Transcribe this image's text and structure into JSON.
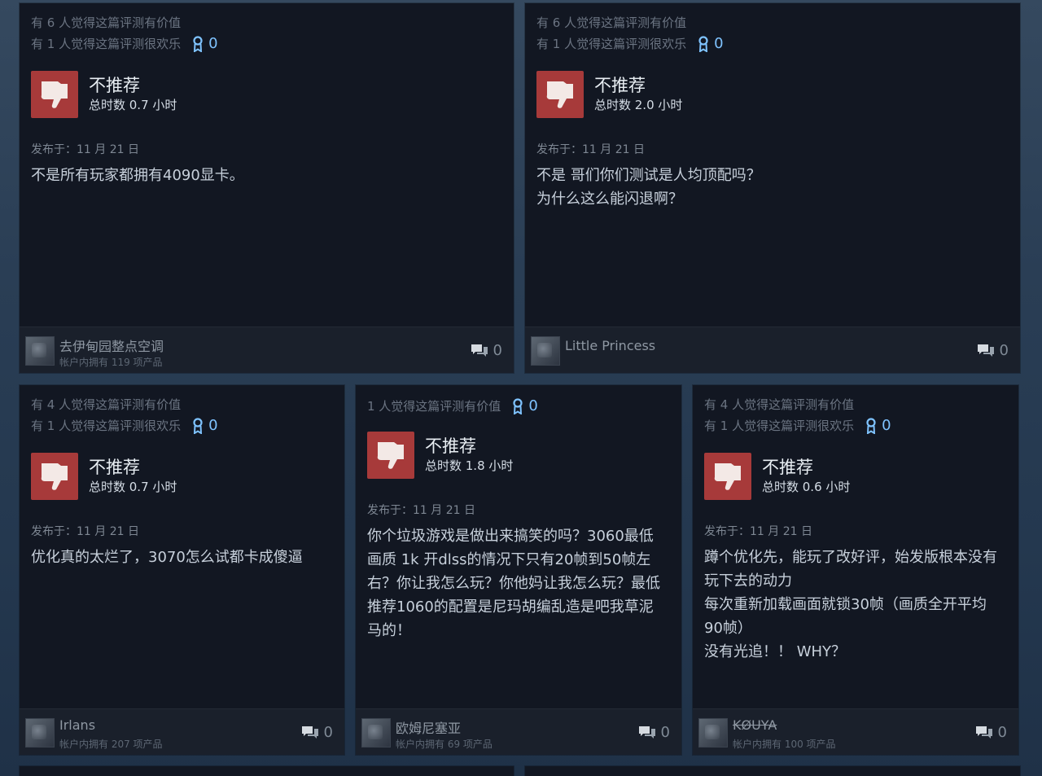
{
  "reviews": [
    {
      "helpful_valuable": "有 6 人觉得这篇评测有价值",
      "helpful_funny": "有 1 人觉得这篇评测很欢乐",
      "award_count": "0",
      "verdict": "不推荐",
      "playtime": "总时数 0.7 小时",
      "posted": "发布于：11 月 21 日",
      "content": [
        "不是所有玩家都拥有4090显卡。"
      ],
      "author": "去伊甸园整点空调",
      "owned": "帐户内拥有 119 项产品",
      "comments": "0"
    },
    {
      "helpful_valuable": "有 6 人觉得这篇评测有价值",
      "helpful_funny": "有 1 人觉得这篇评测很欢乐",
      "award_count": "0",
      "verdict": "不推荐",
      "playtime": "总时数 2.0 小时",
      "posted": "发布于：11 月 21 日",
      "content": [
        "不是 哥们你们测试是人均顶配吗？",
        "为什么这么能闪退啊？"
      ],
      "author": "Little Princess",
      "owned": "",
      "comments": "0"
    },
    {
      "helpful_valuable": "有 4 人觉得这篇评测有价值",
      "helpful_funny": "有 1 人觉得这篇评测很欢乐",
      "award_count": "0",
      "verdict": "不推荐",
      "playtime": "总时数 0.7 小时",
      "posted": "发布于：11 月 21 日",
      "content": [
        "优化真的太烂了，3070怎么试都卡成傻逼"
      ],
      "author": "Irlans",
      "owned": "帐户内拥有 207 项产品",
      "comments": "0"
    },
    {
      "helpful_valuable": "1 人觉得这篇评测有价值",
      "helpful_funny": "",
      "award_count": "0",
      "verdict": "不推荐",
      "playtime": "总时数 1.8 小时",
      "posted": "发布于：11 月 21 日",
      "content": [
        "你个垃圾游戏是做出来搞笑的吗？3060最低",
        "画质 1k 开dlss的情况下只有20帧到50帧左",
        "右？你让我怎么玩？你他妈让我怎么玩？最低",
        "推荐1060的配置是尼玛胡编乱造是吧我草泥",
        "马的！"
      ],
      "author": "欧姆尼塞亚",
      "owned": "帐户内拥有 69 项产品",
      "comments": "0"
    },
    {
      "helpful_valuable": "有 4 人觉得这篇评测有价值",
      "helpful_funny": "有 1 人觉得这篇评测很欢乐",
      "award_count": "0",
      "verdict": "不推荐",
      "playtime": "总时数 0.6 小时",
      "posted": "发布于：11 月 21 日",
      "content": [
        "蹲个优化先，能玩了改好评，始发版根本没有",
        "玩下去的动力",
        "每次重新加载画面就锁30帧（画质全开平均",
        "90帧）",
        "没有光追！！ WHY？"
      ],
      "author": "KØUYA",
      "owned": "帐户内拥有 100 项产品",
      "comments": "0"
    }
  ],
  "colors": {
    "thumb_bg": "#a73a3a",
    "card_bg": "#121722",
    "award": "#7fc3ff"
  },
  "icons": {
    "verdict": "thumbs-down-icon",
    "award": "award-ribbon-icon",
    "comments": "comment-bubbles-icon"
  }
}
